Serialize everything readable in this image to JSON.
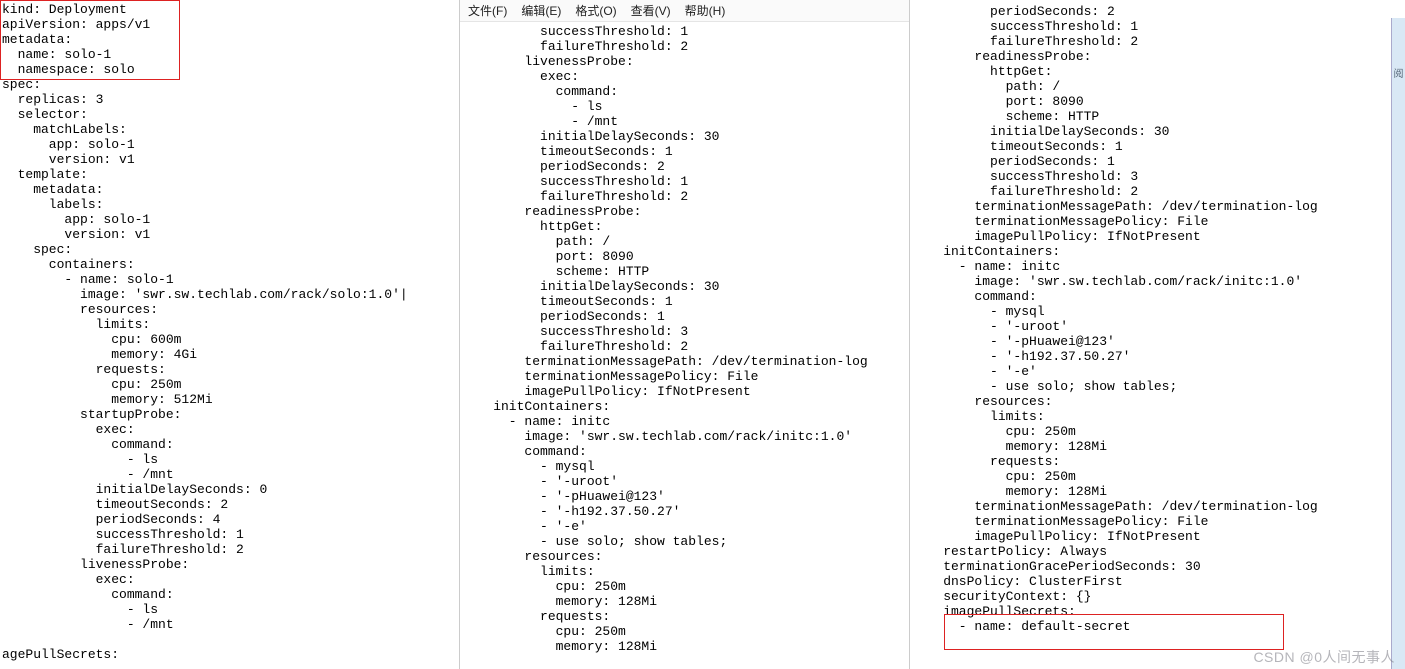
{
  "menubar": {
    "file": "文件(F)",
    "edit": "编辑(E)",
    "format": "格式(O)",
    "view": "查看(V)",
    "help": "帮助(H)"
  },
  "watermark": "CSDN @0人间无事人",
  "right_sidebar_hint": "阅",
  "pane1_lines": [
    "kind: Deployment",
    "apiVersion: apps/v1",
    "metadata:",
    "  name: solo-1",
    "  namespace: solo",
    "spec:",
    "  replicas: 3",
    "  selector:",
    "    matchLabels:",
    "      app: solo-1",
    "      version: v1",
    "  template:",
    "    metadata:",
    "      labels:",
    "        app: solo-1",
    "        version: v1",
    "    spec:",
    "      containers:",
    "        - name: solo-1",
    "          image: 'swr.sw.techlab.com/rack/solo:1.0'|",
    "          resources:",
    "            limits:",
    "              cpu: 600m",
    "              memory: 4Gi",
    "            requests:",
    "              cpu: 250m",
    "              memory: 512Mi",
    "          startupProbe:",
    "            exec:",
    "              command:",
    "                - ls",
    "                - /mnt",
    "            initialDelaySeconds: 0",
    "            timeoutSeconds: 2",
    "            periodSeconds: 4",
    "            successThreshold: 1",
    "            failureThreshold: 2",
    "          livenessProbe:",
    "            exec:",
    "              command:",
    "                - ls",
    "                - /mnt",
    "",
    "agePullSecrets:"
  ],
  "pane2_lines": [
    "          successThreshold: 1",
    "          failureThreshold: 2",
    "        livenessProbe:",
    "          exec:",
    "            command:",
    "              - ls",
    "              - /mnt",
    "          initialDelaySeconds: 30",
    "          timeoutSeconds: 1",
    "          periodSeconds: 2",
    "          successThreshold: 1",
    "          failureThreshold: 2",
    "        readinessProbe:",
    "          httpGet:",
    "            path: /",
    "            port: 8090",
    "            scheme: HTTP",
    "          initialDelaySeconds: 30",
    "          timeoutSeconds: 1",
    "          periodSeconds: 1",
    "          successThreshold: 3",
    "          failureThreshold: 2",
    "        terminationMessagePath: /dev/termination-log",
    "        terminationMessagePolicy: File",
    "        imagePullPolicy: IfNotPresent",
    "    initContainers:",
    "      - name: initc",
    "        image: 'swr.sw.techlab.com/rack/initc:1.0'",
    "        command:",
    "          - mysql",
    "          - '-uroot'",
    "          - '-pHuawei@123'",
    "          - '-h192.37.50.27'",
    "          - '-e'",
    "          - use solo; show tables;",
    "        resources:",
    "          limits:",
    "            cpu: 250m",
    "            memory: 128Mi",
    "          requests:",
    "            cpu: 250m",
    "            memory: 128Mi"
  ],
  "pane3_lines": [
    "          periodSeconds: 2",
    "          successThreshold: 1",
    "          failureThreshold: 2",
    "        readinessProbe:",
    "          httpGet:",
    "            path: /",
    "            port: 8090",
    "            scheme: HTTP",
    "          initialDelaySeconds: 30",
    "          timeoutSeconds: 1",
    "          periodSeconds: 1",
    "          successThreshold: 3",
    "          failureThreshold: 2",
    "        terminationMessagePath: /dev/termination-log",
    "        terminationMessagePolicy: File",
    "        imagePullPolicy: IfNotPresent",
    "    initContainers:",
    "      - name: initc",
    "        image: 'swr.sw.techlab.com/rack/initc:1.0'",
    "        command:",
    "          - mysql",
    "          - '-uroot'",
    "          - '-pHuawei@123'",
    "          - '-h192.37.50.27'",
    "          - '-e'",
    "          - use solo; show tables;",
    "        resources:",
    "          limits:",
    "            cpu: 250m",
    "            memory: 128Mi",
    "          requests:",
    "            cpu: 250m",
    "            memory: 128Mi",
    "        terminationMessagePath: /dev/termination-log",
    "        terminationMessagePolicy: File",
    "        imagePullPolicy: IfNotPresent",
    "    restartPolicy: Always",
    "    terminationGracePeriodSeconds: 30",
    "    dnsPolicy: ClusterFirst",
    "    securityContext: {}",
    "    imagePullSecrets:",
    "      - name: default-secret"
  ]
}
